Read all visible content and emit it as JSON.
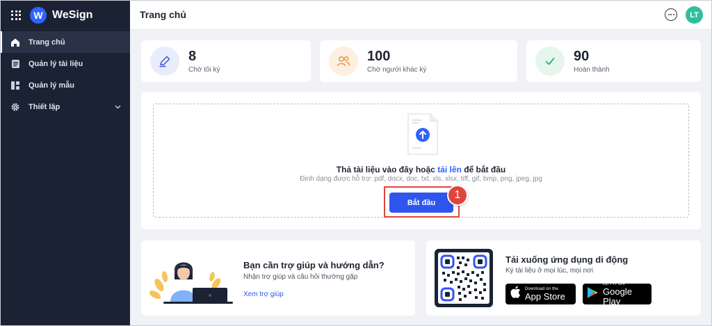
{
  "app": {
    "brand": "WeSign",
    "logo_letter": "W"
  },
  "sidebar": {
    "items": [
      {
        "label": "Trang chủ",
        "icon": "home-icon",
        "active": true
      },
      {
        "label": "Quản lý tài liệu",
        "icon": "document-icon",
        "active": false
      },
      {
        "label": "Quản lý mẫu",
        "icon": "template-icon",
        "active": false
      },
      {
        "label": "Thiết lập",
        "icon": "gear-icon",
        "active": false,
        "expandable": true
      }
    ]
  },
  "header": {
    "title": "Trang chủ",
    "avatar_initials": "LT"
  },
  "stats": [
    {
      "value": "8",
      "label": "Chờ tôi ký",
      "icon": "pen-icon",
      "color": "#3c55d8"
    },
    {
      "value": "100",
      "label": "Chờ người khác ký",
      "icon": "users-icon",
      "color": "#f0943a"
    },
    {
      "value": "90",
      "label": "Hoàn thành",
      "icon": "check-icon",
      "color": "#2bb673"
    }
  ],
  "upload": {
    "prompt_before": "Thả tài liệu vào đây hoặc ",
    "prompt_link": "tải lên",
    "prompt_after": " để bắt đầu",
    "formats": "Định dạng được hỗ trợ: pdf, docx, doc, txt, xls, xlsx, tiff, gif, bmp, png, jpeg, jpg",
    "button_label": "Bắt đầu",
    "step_badge": "1"
  },
  "help": {
    "title": "Bạn cần trợ giúp và hướng dẫn?",
    "subtitle": "Nhận trợ giúp và câu hỏi thường gặp",
    "link": "Xem trợ giúp"
  },
  "mobile": {
    "title": "Tải xuống ứng dụng di động",
    "subtitle": "Ký tài liệu ở mọi lúc, mọi nơi",
    "app_store": {
      "small": "Download on the",
      "big": "App Store"
    },
    "google_play": {
      "small": "GET IT ON",
      "big": "Google Play"
    }
  },
  "colors": {
    "sidebar_bg": "#1b2234",
    "accent": "#2f55ef",
    "highlight": "#e0443e",
    "avatar": "#2fbfa0"
  }
}
